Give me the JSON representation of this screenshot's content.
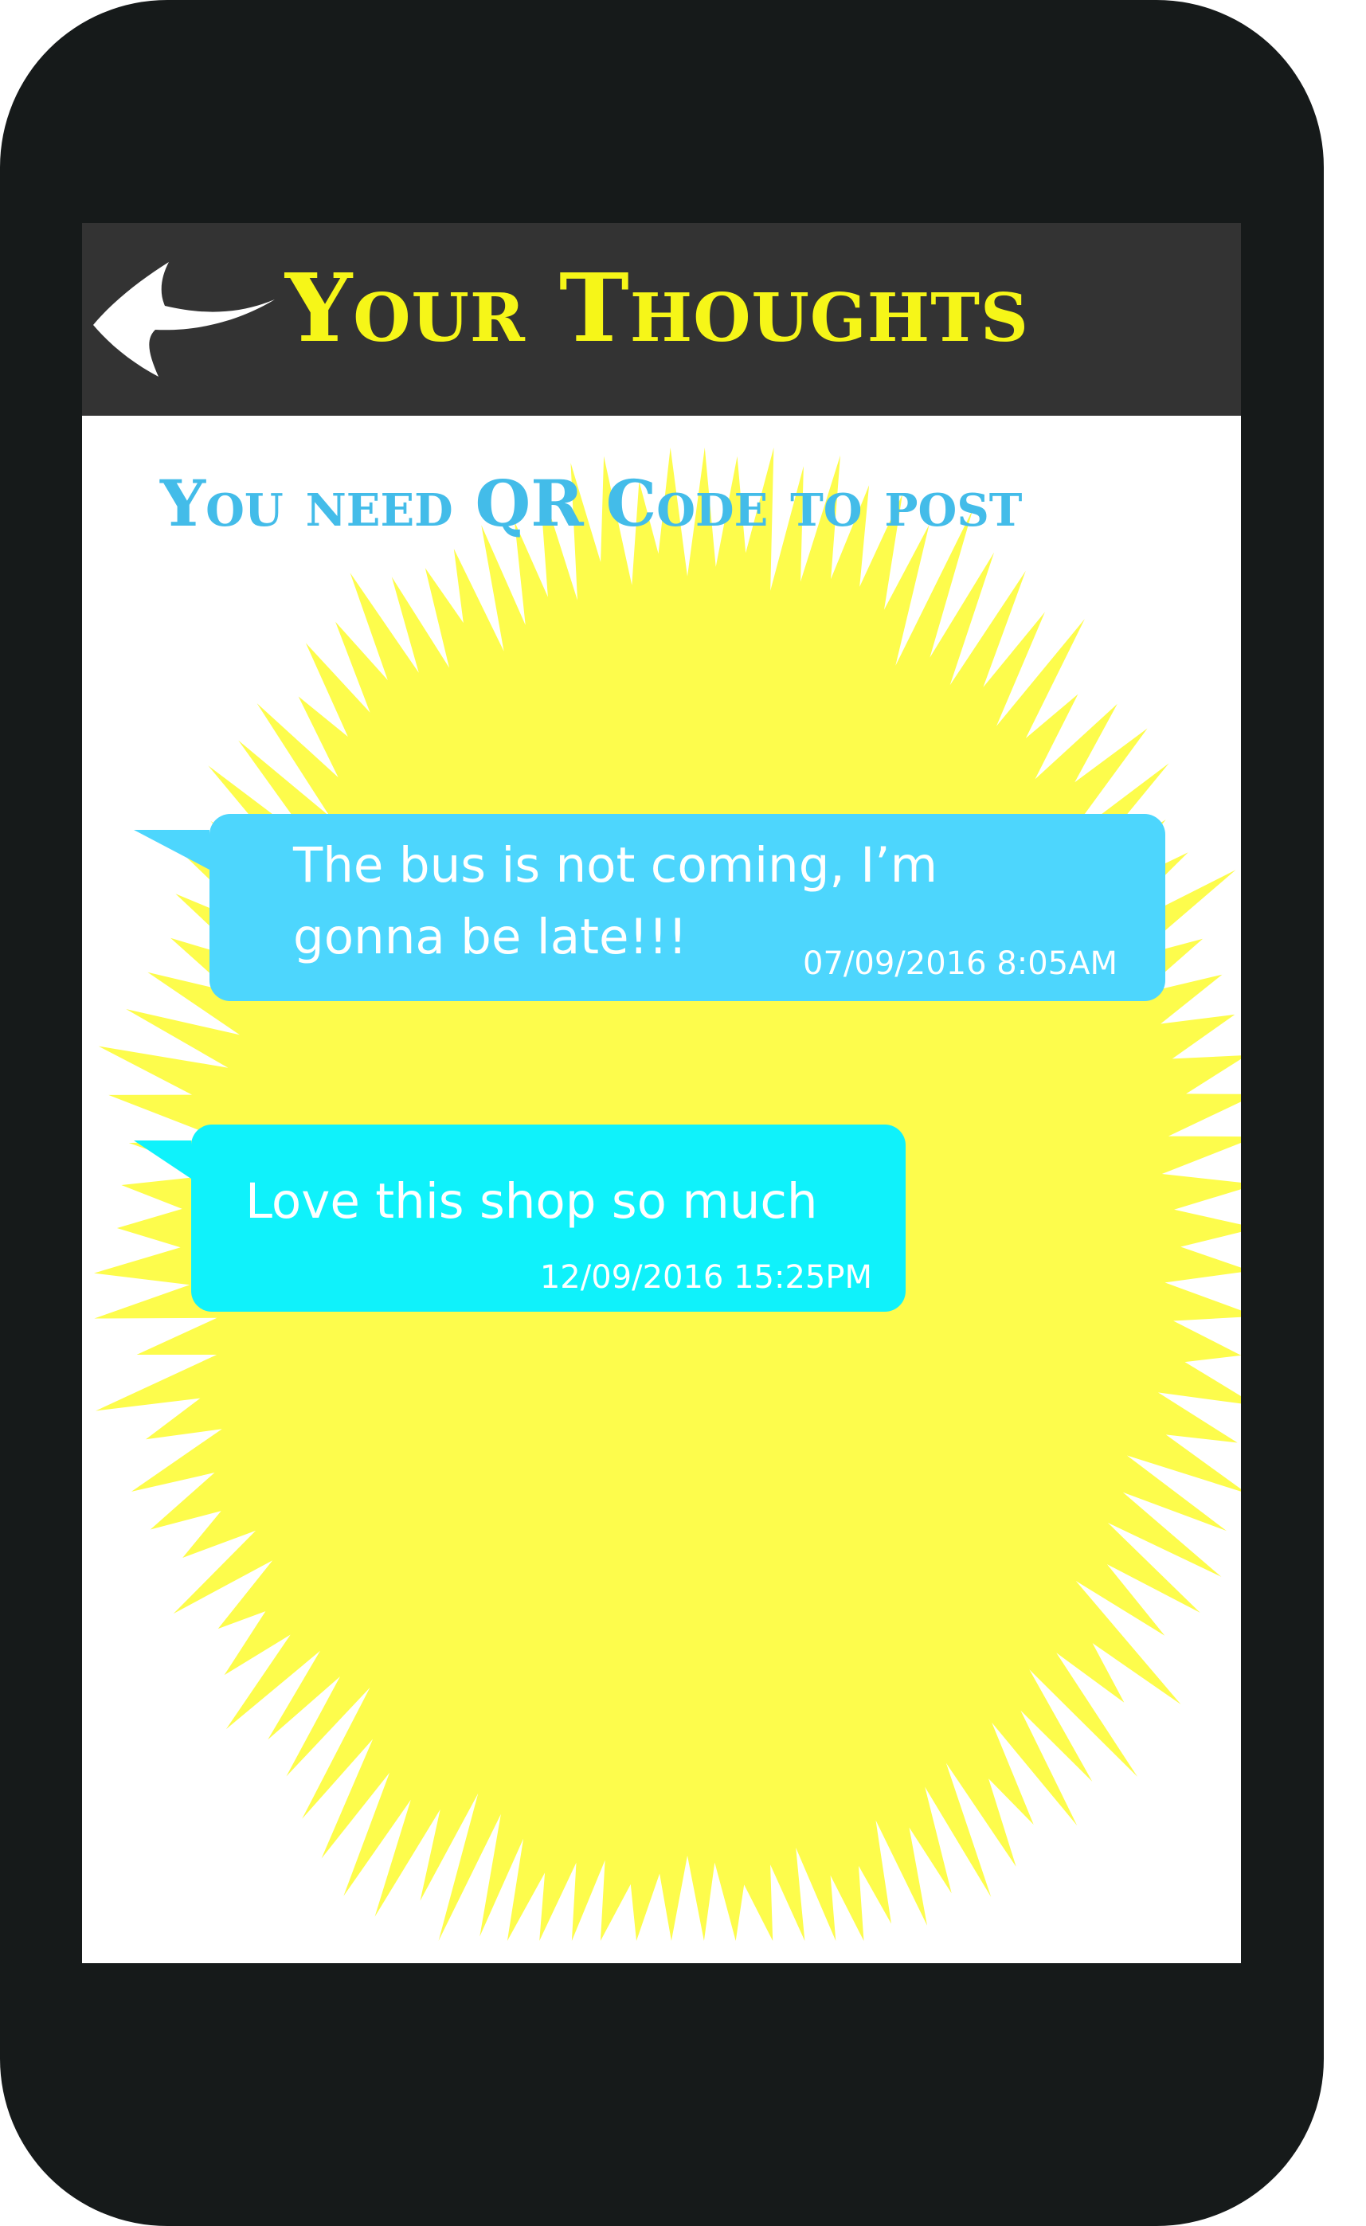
{
  "header": {
    "title": "Your Thoughts",
    "back_icon": "back-arrow-icon"
  },
  "notice": "You need QR Code to post",
  "messages": [
    {
      "text": "The bus is not coming, I’m gonna be late!!!",
      "time": "07/09/2016 8:05AM",
      "color": "#4dd6fd"
    },
    {
      "text": "Love this shop so much",
      "time": "12/09/2016 15:25PM",
      "color": "#0ff2fb"
    }
  ],
  "colors": {
    "phone_frame": "#161a1a",
    "header_bar": "#333333",
    "title": "#f6f618",
    "notice": "#43bce9",
    "splash": "#fdfc4c"
  }
}
